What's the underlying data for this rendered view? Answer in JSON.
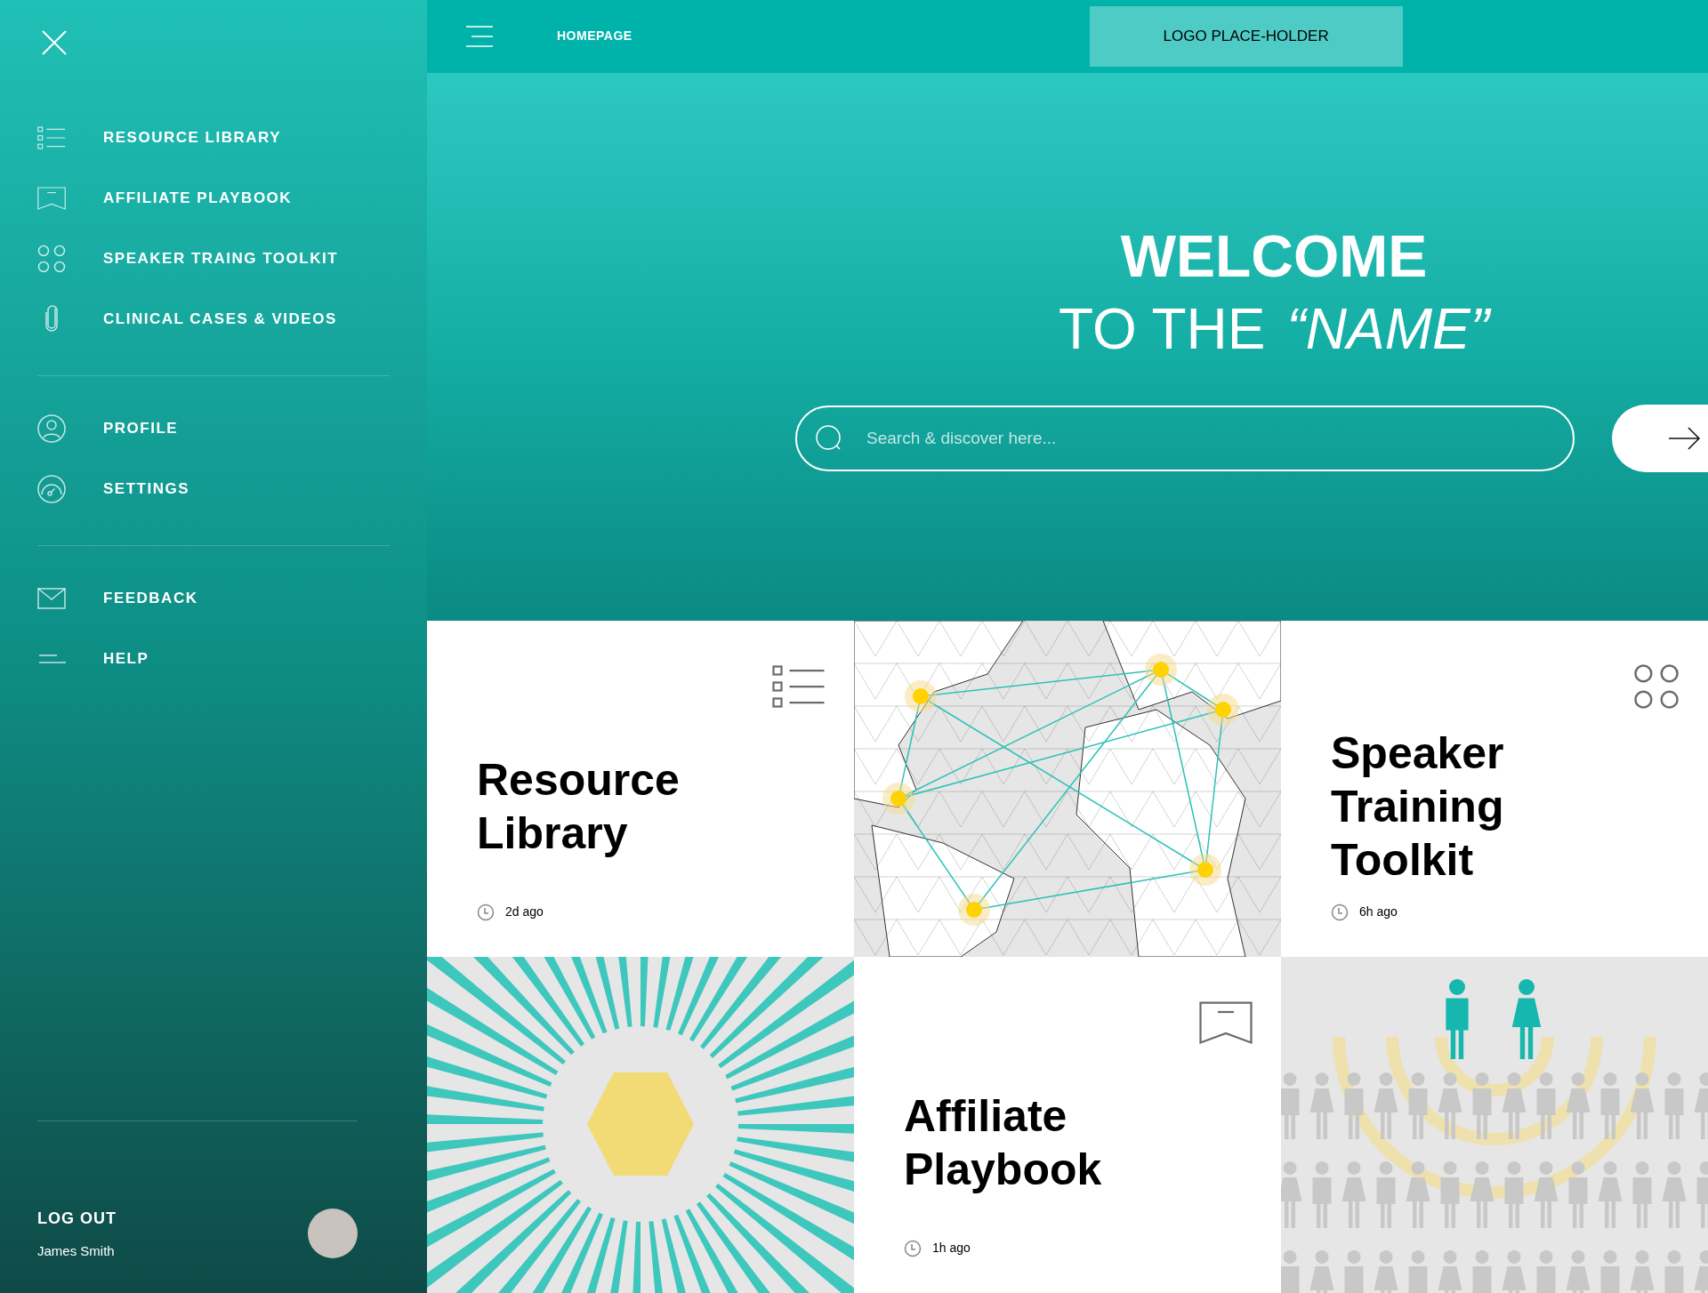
{
  "sidebar": {
    "sections": [
      {
        "items": [
          {
            "label": "RESOURCE LIBRARY",
            "kind": "list"
          },
          {
            "label": "AFFILIATE PLAYBOOK",
            "kind": "bookmark"
          },
          {
            "label": "SPEAKER TRAING TOOLKIT",
            "kind": "dots"
          },
          {
            "label": "CLINICAL CASES & VIDEOS",
            "kind": "clip"
          }
        ]
      },
      {
        "items": [
          {
            "label": "PROFILE",
            "kind": "user"
          },
          {
            "label": "SETTINGS",
            "kind": "gauge"
          }
        ]
      },
      {
        "items": [
          {
            "label": "FEEDBACK",
            "kind": "mail"
          },
          {
            "label": "HELP",
            "kind": "lines"
          }
        ]
      }
    ],
    "logout": "LOG OUT",
    "user_name": "James Smith"
  },
  "header": {
    "title": "HOMEPAGE",
    "logo": "LOGO PLACE-HOLDER"
  },
  "hero": {
    "title": "WELCOME",
    "subtitle": "TO THE",
    "subtitle_emphasis": "“NAME”",
    "search": {
      "placeholder": "Search & discover here..."
    }
  },
  "cards": [
    {
      "kind": "list",
      "title": "Resource Library",
      "time": "2d ago"
    },
    {
      "kind": "map"
    },
    {
      "kind": "dots",
      "title": "Speaker Training Toolkit",
      "time": "6h ago"
    },
    {
      "kind": "sunburst"
    },
    {
      "kind": "bookmark",
      "title": "Affiliate Playbook",
      "time": "1h ago"
    },
    {
      "kind": "people"
    }
  ]
}
